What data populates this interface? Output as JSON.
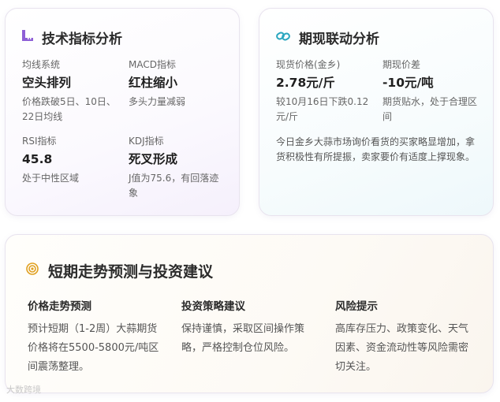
{
  "tech": {
    "title": "技术指标分析",
    "icon": "ruler-icon",
    "metrics": [
      {
        "label": "均线系统",
        "value": "空头排列",
        "desc": "价格跌破5日、10日、22日均线"
      },
      {
        "label": "MACD指标",
        "value": "红柱缩小",
        "desc": "多头力量减弱"
      },
      {
        "label": "RSI指标",
        "value": "45.8",
        "desc": "处于中性区域"
      },
      {
        "label": "KDJ指标",
        "value": "死叉形成",
        "desc": "J值为75.6，有回落迹象"
      }
    ]
  },
  "link": {
    "title": "期现联动分析",
    "icon": "link-icon",
    "metrics": [
      {
        "label": "现货价格(金乡)",
        "value": "2.78元/斤",
        "desc": "较10月16日下跌0.12元/斤"
      },
      {
        "label": "期现价差",
        "value": "-10元/吨",
        "desc": "期货贴水，处于合理区间"
      }
    ],
    "note": "今日金乡大蒜市场询价看货的买家略显增加，拿货积极性有所提振，卖家要价有适度上撑现象。"
  },
  "forecast": {
    "title": "短期走势预测与投资建议",
    "icon": "target-icon",
    "columns": [
      {
        "title": "价格走势预测",
        "text": "预计短期（1-2周）大蒜期货价格将在5500-5800元/吨区间震荡整理。"
      },
      {
        "title": "投资策略建议",
        "text": "保持谨慎，采取区间操作策略，严格控制仓位风险。"
      },
      {
        "title": "风险提示",
        "text": "高库存压力、政策变化、天气因素、资金流动性等风险需密切关注。"
      }
    ]
  },
  "watermark": "大数跨境",
  "colors": {
    "tech_icon": "#8e5fd6",
    "link_icon": "#2aa6bf",
    "target_icon": "#e0a020"
  }
}
